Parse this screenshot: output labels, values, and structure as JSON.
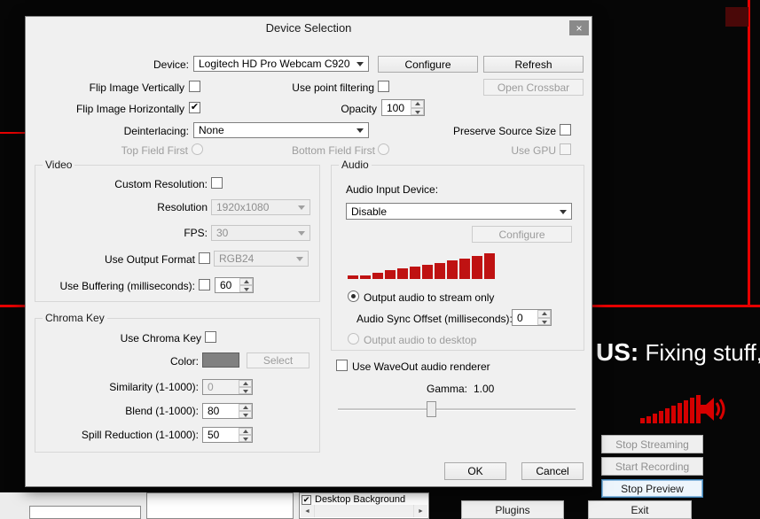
{
  "icons": {
    "close": "×",
    "checkmark": "✔",
    "scroll_left": "◄",
    "scroll_right": "►"
  },
  "colors": {
    "scene_red": "#e60000",
    "meter_red": "#bf1212",
    "chroma_swatch": "#808080"
  },
  "dialog": {
    "title": "Device Selection",
    "top": {
      "device_label": "Device:",
      "device_value": "Logitech HD Pro Webcam C920",
      "configure_btn": "Configure",
      "refresh_btn": "Refresh",
      "flip_vertical_label": "Flip Image Vertically",
      "point_filtering_label": "Use point filtering",
      "open_crossbar_btn": "Open Crossbar",
      "flip_horizontal_label": "Flip Image Horizontally",
      "opacity_label": "Opacity",
      "opacity_value": "100",
      "deinterlacing_label": "Deinterlacing:",
      "deinterlacing_value": "None",
      "preserve_source_label": "Preserve Source Size",
      "top_field_label": "Top Field First",
      "bottom_field_label": "Bottom Field First",
      "use_gpu_label": "Use GPU"
    },
    "video": {
      "group_title": "Video",
      "custom_resolution_label": "Custom Resolution:",
      "resolution_label": "Resolution",
      "resolution_value": "1920x1080",
      "fps_label": "FPS:",
      "fps_value": "30",
      "output_format_label": "Use Output Format",
      "output_format_value": "RGB24",
      "buffering_label": "Use Buffering (milliseconds):",
      "buffering_value": "60"
    },
    "audio": {
      "group_title": "Audio",
      "input_device_label": "Audio Input Device:",
      "input_device_value": "Disable",
      "configure_btn": "Configure",
      "meter_bars": [
        4,
        4,
        7,
        10,
        12,
        14,
        16,
        18,
        21,
        23,
        26,
        29
      ],
      "stream_only_label": "Output audio to stream only",
      "sync_offset_label": "Audio Sync Offset (milliseconds):",
      "sync_offset_value": "0",
      "desktop_label": "Output audio to desktop"
    },
    "chroma": {
      "group_title": "Chroma Key",
      "use_chroma_label": "Use Chroma Key",
      "color_label": "Color:",
      "select_btn": "Select",
      "similarity_label": "Similarity (1-1000):",
      "similarity_value": "0",
      "blend_label": "Blend (1-1000):",
      "blend_value": "80",
      "spill_label": "Spill Reduction (1-1000):",
      "spill_value": "50"
    },
    "footer": {
      "waveout_label": "Use WaveOut audio renderer",
      "gamma_label": "Gamma:",
      "gamma_value": "1.00",
      "ok_btn": "OK",
      "cancel_btn": "Cancel"
    }
  },
  "background": {
    "overlay_bold": "US:",
    "overlay_text": " Fixing stuff, n",
    "scene_meter_bars": [
      6,
      8,
      11,
      14,
      17,
      20,
      23,
      26,
      29,
      32
    ],
    "stop_streaming_btn": "Stop Streaming",
    "start_recording_btn": "Start Recording",
    "stop_preview_btn": "Stop Preview",
    "plugins_btn": "Plugins",
    "exit_btn": "Exit",
    "source_item_label": "Desktop Background"
  }
}
